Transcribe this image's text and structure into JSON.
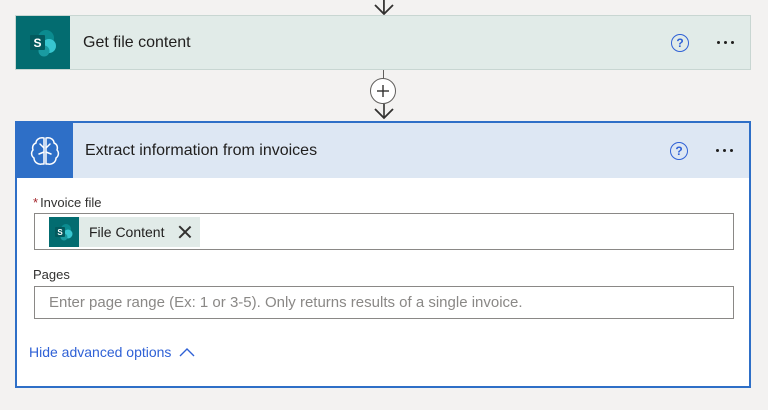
{
  "steps": [
    {
      "title": "Get file content",
      "icon": "sharepoint-icon",
      "icon_letter": "S",
      "accent": "#036c70",
      "help_label": "?"
    },
    {
      "title": "Extract information from invoices",
      "icon": "ai-builder-brain-icon",
      "accent": "#2e6fc7",
      "help_label": "?",
      "fields": {
        "invoice_file": {
          "label": "Invoice file",
          "required_marker": "*",
          "token_label": "File Content",
          "token_icon_letter": "S"
        },
        "pages": {
          "label": "Pages",
          "placeholder": "Enter page range (Ex: 1 or 3-5). Only returns results of a single invoice."
        }
      },
      "advanced_toggle": "Hide advanced options"
    }
  ],
  "colors": {
    "background": "#f3f2f1",
    "link": "#2f61d6",
    "required": "#a4262c"
  }
}
